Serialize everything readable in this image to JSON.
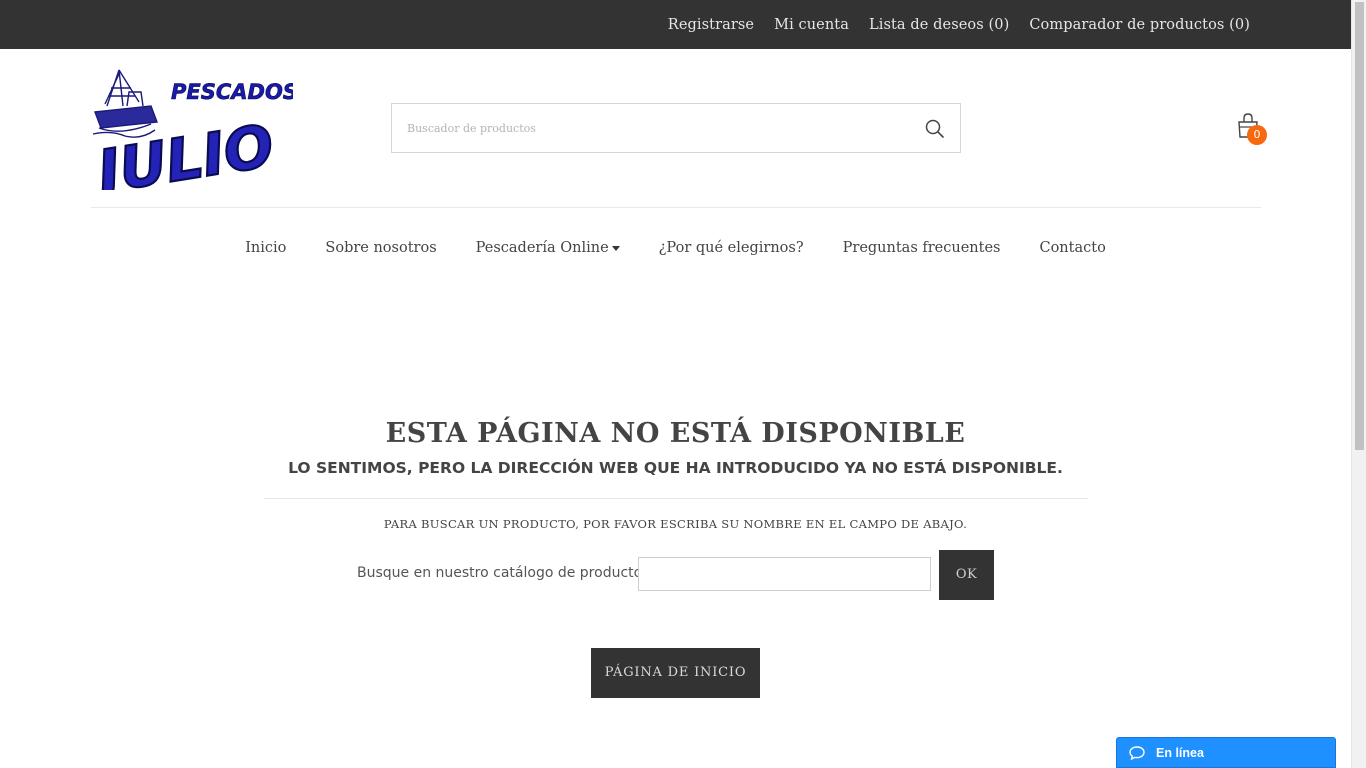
{
  "topbar": {
    "links": [
      {
        "label": "Registrarse"
      },
      {
        "label": "Mi cuenta"
      },
      {
        "label": "Lista de deseos (0)"
      },
      {
        "label": "Comparador de productos (0)"
      }
    ]
  },
  "header": {
    "logo_text_top": "PESCADOS",
    "logo_text_main": "JULIO",
    "search_placeholder": "Buscador de productos",
    "cart_count": "0",
    "accent_color": "#f7680f"
  },
  "nav": {
    "items": [
      {
        "label": "Inicio"
      },
      {
        "label": "Sobre nosotros"
      },
      {
        "label": "Pescadería Online",
        "has_dropdown": true
      },
      {
        "label": "¿Por qué elegirnos?"
      },
      {
        "label": "Preguntas frecuentes"
      },
      {
        "label": "Contacto"
      }
    ]
  },
  "content": {
    "title": "ESTA PÁGINA NO ESTÁ DISPONIBLE",
    "subtitle": "LO SENTIMOS, PERO LA DIRECCIÓN WEB QUE HA INTRODUCIDO YA NO ESTÁ DISPONIBLE.",
    "hint": "PARA BUSCAR UN PRODUCTO, POR FAVOR ESCRIBA SU NOMBRE EN EL CAMPO DE ABAJO.",
    "catalog_label": "Busque en nuestro catálogo de productos:",
    "catalog_value": "",
    "ok_label": "OK",
    "home_label": "PÁGINA DE INICIO"
  },
  "chat": {
    "label": "En línea",
    "color": "#1e90ff"
  }
}
